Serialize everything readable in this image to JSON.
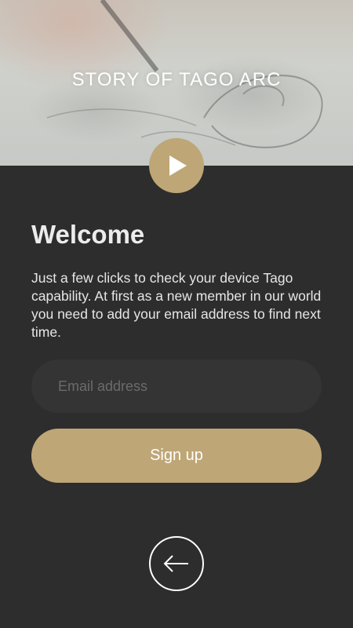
{
  "hero": {
    "title": "STORY OF TAGO ARC",
    "play_icon": "play-icon"
  },
  "welcome": {
    "heading": "Welcome",
    "body": "Just a few clicks to check your device Tago capability. At first as a new member in our world you need to add your email address to find next time."
  },
  "form": {
    "email_placeholder": "Email address",
    "email_value": "",
    "signup_label": "Sign up"
  },
  "footer": {
    "back_icon": "arrow-left-icon"
  },
  "colors": {
    "accent": "#bea676",
    "background": "#2d2d2d",
    "input_background": "#343434"
  }
}
